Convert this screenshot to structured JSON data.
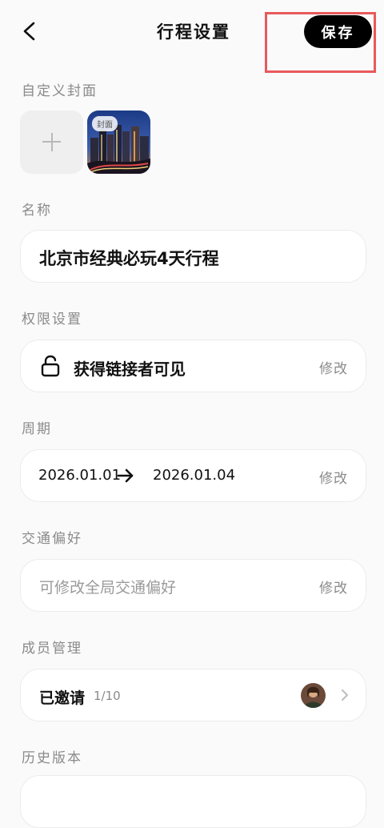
{
  "header": {
    "title": "行程设置",
    "save_label": "保存"
  },
  "cover_section": {
    "label": "自定义封面",
    "badge": "封面"
  },
  "name_section": {
    "label": "名称",
    "value": "北京市经典必玩4天行程"
  },
  "permission_section": {
    "label": "权限设置",
    "value": "获得链接者可见",
    "action": "修改"
  },
  "period_section": {
    "label": "周期",
    "start": "2026.01.01",
    "end": "2026.01.04",
    "action": "修改"
  },
  "transport_section": {
    "label": "交通偏好",
    "placeholder": "可修改全局交通偏好",
    "action": "修改"
  },
  "members_section": {
    "label": "成员管理",
    "value": "已邀请",
    "count": "1/10"
  },
  "history_section": {
    "label": "历史版本"
  },
  "colors": {
    "accent": "#000000",
    "highlight": "#e8595c",
    "muted": "#8a8a8a"
  }
}
